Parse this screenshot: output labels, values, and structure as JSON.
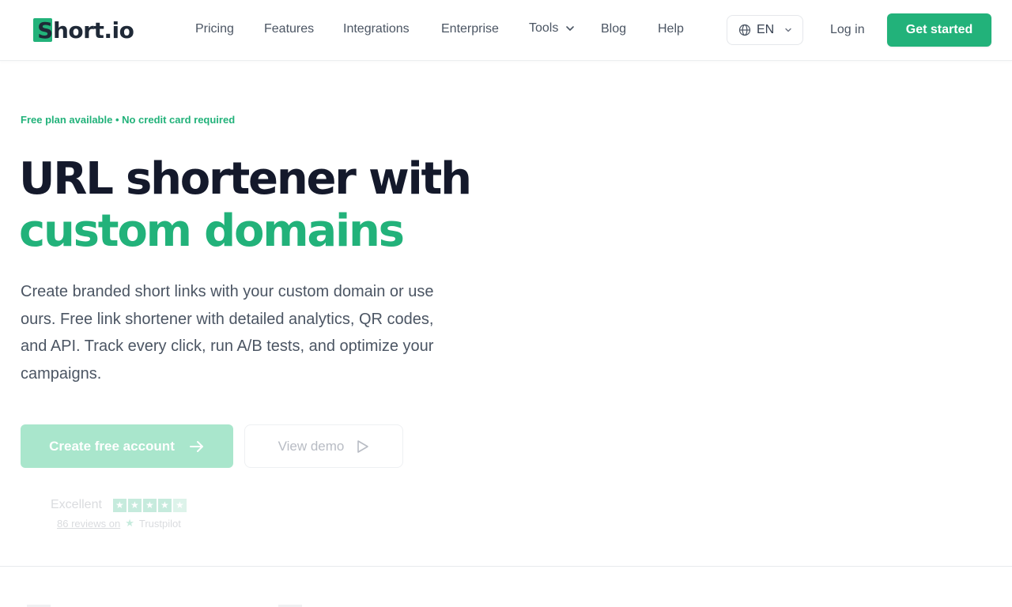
{
  "brand": {
    "name": "Short.io",
    "logo_letter": "S",
    "logo_rest": "hort.io",
    "accent": "#22b27a"
  },
  "nav": {
    "items": [
      {
        "label": "Pricing"
      },
      {
        "label": "Features"
      },
      {
        "label": "Integrations"
      },
      {
        "label": "Enterprise"
      },
      {
        "label": "Tools"
      },
      {
        "label": "Blog"
      },
      {
        "label": "Help"
      }
    ],
    "language": "EN",
    "login": "Log in",
    "cta": "Get started"
  },
  "hero": {
    "eyebrow": "Free plan available • No credit card required",
    "title_line1": "URL shortener with",
    "title_line2": "custom domains",
    "description": "Create branded short links with your custom domain or use ours. Free link shortener with detailed analytics, QR codes, and API. Track every click, run A/B tests, and optimize your campaigns.",
    "primary_button": "Create free account",
    "secondary_button": "View demo"
  },
  "trust": {
    "rating_label": "Excellent",
    "reviews_link": "86 reviews on",
    "platform": "Trustpilot"
  }
}
